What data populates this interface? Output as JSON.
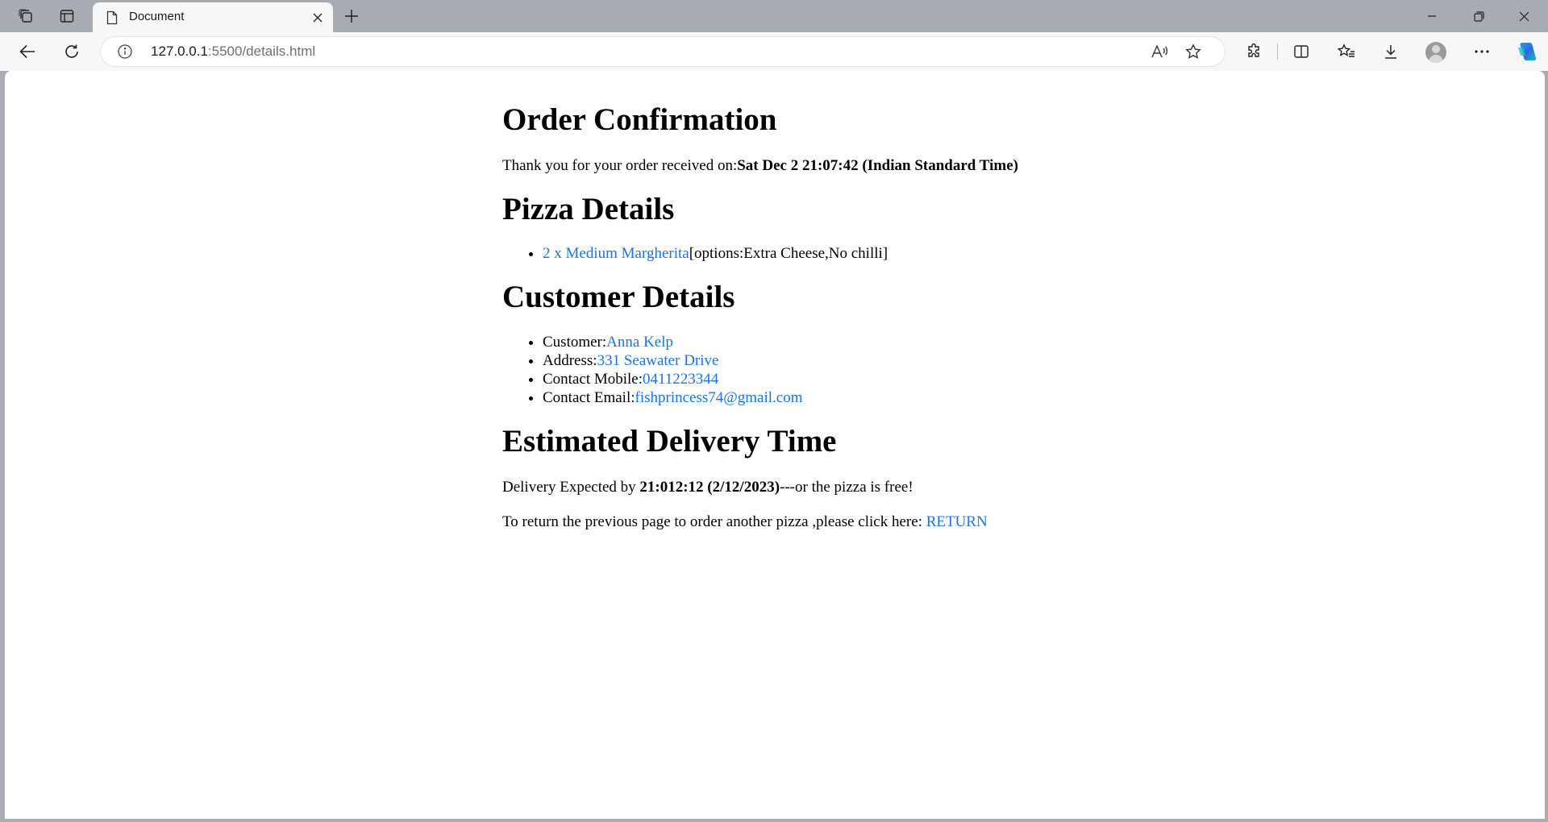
{
  "browser": {
    "tab_title": "Document",
    "url_host": "127.0.0.1",
    "url_rest": ":5500/details.html"
  },
  "page": {
    "heading_order": "Order Confirmation",
    "thank_you_prefix": "Thank you for your order received on:",
    "order_time": "Sat Dec 2 21:07:42 (Indian Standard Time)",
    "heading_pizza": "Pizza Details",
    "pizza_item_link": "2 x Medium Margherita",
    "pizza_item_options": "[options:Extra Cheese,No chilli]",
    "heading_customer": "Customer Details",
    "customer": [
      {
        "label": "Customer:",
        "value": "Anna Kelp"
      },
      {
        "label": "Address:",
        "value": "331 Seawater Drive"
      },
      {
        "label": "Contact Mobile:",
        "value": "0411223344"
      },
      {
        "label": "Contact Email:",
        "value": "fishprincess74@gmail.com"
      }
    ],
    "heading_delivery": "Estimated Delivery Time",
    "delivery_prefix": "Delivery Expected by ",
    "delivery_time": "21:012:12 (2/12/2023)",
    "delivery_suffix": "---or the pizza is free!",
    "return_prefix": "To return the previous page to order another pizza ,please click here: ",
    "return_link": "RETURN"
  },
  "colors": {
    "link": "#1a73e8",
    "chrome": "#a7abb2",
    "toolbar": "#f7f7f7"
  },
  "icons": [
    "workspaces-icon",
    "tab-actions-icon",
    "page-icon",
    "close-icon",
    "plus-icon",
    "minimize-icon",
    "restore-icon",
    "window-close-icon",
    "back-arrow-icon",
    "refresh-icon",
    "info-icon",
    "read-aloud-icon",
    "star-icon",
    "extensions-icon",
    "split-screen-icon",
    "favorites-icon",
    "download-icon",
    "profile-icon",
    "more-icon",
    "copilot-icon"
  ]
}
